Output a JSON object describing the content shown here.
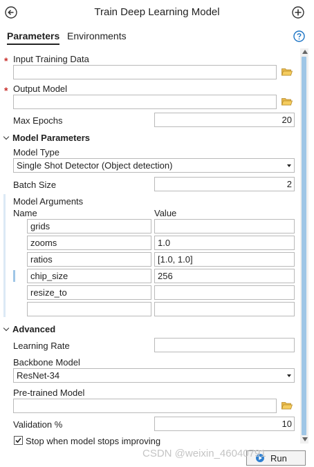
{
  "header": {
    "title": "Train Deep Learning Model",
    "back_icon": "back-arrow-circle-icon",
    "add_icon": "add-circle-icon",
    "help_icon": "help-circle-icon"
  },
  "tabs": [
    {
      "label": "Parameters",
      "active": true
    },
    {
      "label": "Environments",
      "active": false
    }
  ],
  "params": {
    "input_training_data": {
      "label": "Input Training Data",
      "value": "",
      "required": true
    },
    "output_model": {
      "label": "Output Model",
      "value": "",
      "required": true
    },
    "max_epochs": {
      "label": "Max Epochs",
      "value": "20"
    }
  },
  "model_parameters": {
    "section_label": "Model Parameters",
    "model_type": {
      "label": "Model Type",
      "value": "Single Shot Detector (Object detection)"
    },
    "batch_size": {
      "label": "Batch Size",
      "value": "2"
    },
    "model_arguments": {
      "label": "Model Arguments",
      "col_name": "Name",
      "col_value": "Value",
      "rows": [
        {
          "name": "grids",
          "value": ""
        },
        {
          "name": "zooms",
          "value": "1.0"
        },
        {
          "name": "ratios",
          "value": "[1.0, 1.0]"
        },
        {
          "name": "chip_size",
          "value": "256"
        },
        {
          "name": "resize_to",
          "value": ""
        },
        {
          "name": "",
          "value": ""
        }
      ]
    }
  },
  "advanced": {
    "section_label": "Advanced",
    "learning_rate": {
      "label": "Learning Rate",
      "value": ""
    },
    "backbone_model": {
      "label": "Backbone Model",
      "value": "ResNet-34"
    },
    "pretrained_model": {
      "label": "Pre-trained Model",
      "value": ""
    },
    "validation": {
      "label": "Validation %",
      "value": "10"
    },
    "stop_improving": {
      "label": "Stop when model stops improving",
      "checked": true
    }
  },
  "footer": {
    "run_label": "Run",
    "watermark": "CSDN @weixin_46040791"
  },
  "colors": {
    "accent": "#1a73c4",
    "required": "#c8302c",
    "scroll_thumb": "#9fc6e6"
  }
}
